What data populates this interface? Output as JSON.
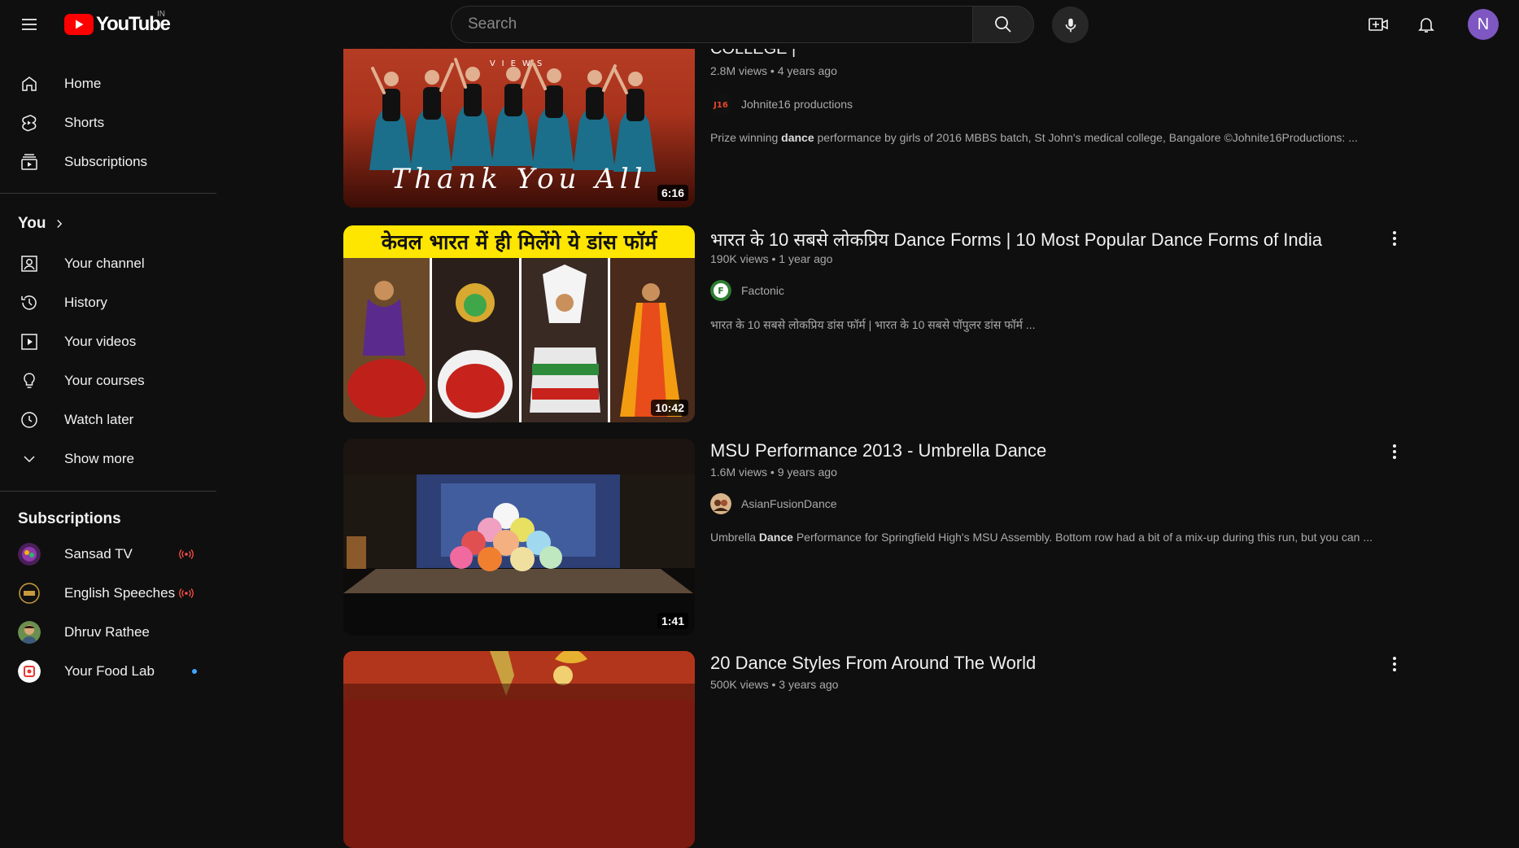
{
  "header": {
    "logo_text": "YouTube",
    "country_code": "IN",
    "search_placeholder": "Search",
    "avatar_letter": "N",
    "brand_color": "#ff0000"
  },
  "sidebar": {
    "main": [
      {
        "label": "Home",
        "icon": "home-icon"
      },
      {
        "label": "Shorts",
        "icon": "shorts-icon"
      },
      {
        "label": "Subscriptions",
        "icon": "subscriptions-icon"
      }
    ],
    "you_heading": "You",
    "you": [
      {
        "label": "Your channel",
        "icon": "your-channel-icon"
      },
      {
        "label": "History",
        "icon": "history-icon"
      },
      {
        "label": "Your videos",
        "icon": "your-videos-icon"
      },
      {
        "label": "Your courses",
        "icon": "courses-icon"
      },
      {
        "label": "Watch later",
        "icon": "watch-later-icon"
      },
      {
        "label": "Show more",
        "icon": "chevron-down-icon"
      }
    ],
    "subscriptions_heading": "Subscriptions",
    "subscriptions": [
      {
        "label": "Sansad TV",
        "status": "live"
      },
      {
        "label": "English Speeches",
        "status": "live"
      },
      {
        "label": "Dhruv Rathee",
        "status": ""
      },
      {
        "label": "Your Food Lab",
        "status": "new"
      }
    ]
  },
  "results": [
    {
      "title": "COLLEGE |",
      "views": "2.8M views",
      "age": "4 years ago",
      "channel": "Johnite16 productions",
      "desc_pre": "Prize winning ",
      "desc_bold": "dance",
      "desc_post": " performance by girls of 2016 MBBS batch, St John's medical college, Bangalore ©Johnite16Productions: ...",
      "duration": "6:16",
      "thumb_text": "Thank You All",
      "thumb_top_text": "VIEWS"
    },
    {
      "title": "भारत के 10 सबसे लोकप्रिय Dance Forms | 10 Most Popular Dance Forms of India",
      "views": "190K views",
      "age": "1 year ago",
      "channel": "Factonic",
      "desc_pre": "भारत के 10 सबसे लोकप्रिय डांस फॉर्म | भारत के 10 सबसे पॉपुलर डांस फॉर्म ...",
      "desc_bold": "",
      "desc_post": "",
      "duration": "10:42",
      "thumb_text": "केवल भारत में ही मिलेंगे ये डांस फॉर्म"
    },
    {
      "title": "MSU Performance 2013 - Umbrella Dance",
      "views": "1.6M views",
      "age": "9 years ago",
      "channel": "AsianFusionDance",
      "desc_pre": "Umbrella ",
      "desc_bold": "Dance",
      "desc_post": " Performance for Springfield High's MSU Assembly. Bottom row had a bit of a mix-up during this run, but you can ...",
      "duration": "1:41"
    },
    {
      "title": "20 Dance Styles From Around The World",
      "views": "500K views",
      "age": "3 years ago"
    }
  ]
}
